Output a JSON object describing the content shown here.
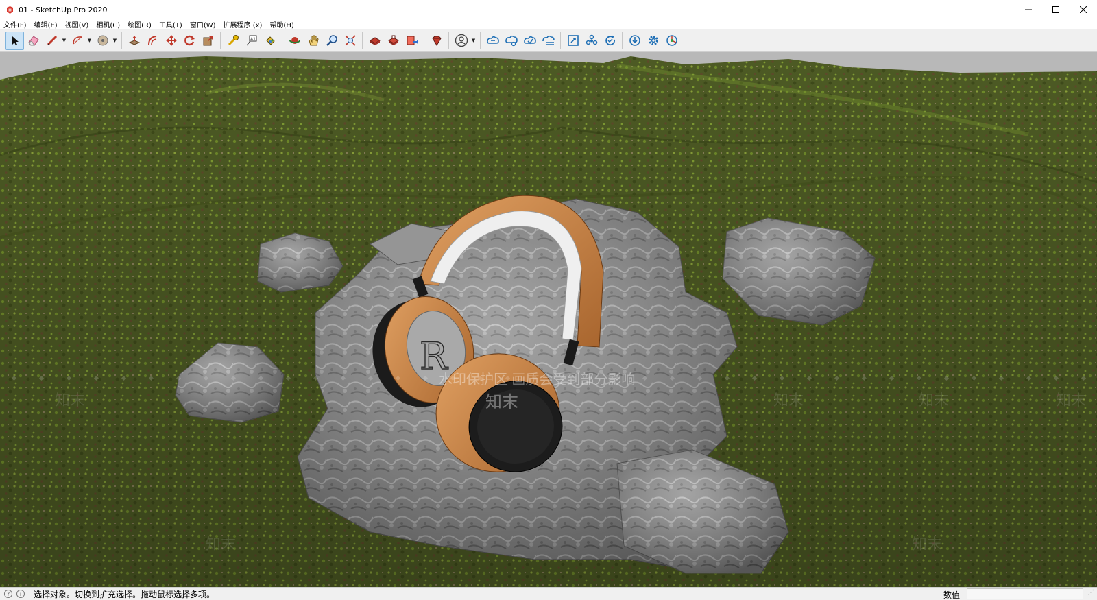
{
  "window": {
    "title": "01 - SketchUp Pro 2020",
    "app_icon": "sketchup-logo-icon",
    "controls": [
      "minimize-icon",
      "maximize-icon",
      "close-icon"
    ]
  },
  "menu": [
    {
      "label": "文件(F)"
    },
    {
      "label": "编辑(E)"
    },
    {
      "label": "视图(V)"
    },
    {
      "label": "相机(C)"
    },
    {
      "label": "绘图(R)"
    },
    {
      "label": "工具(T)"
    },
    {
      "label": "窗口(W)"
    },
    {
      "label": "扩展程序 (x)"
    },
    {
      "label": "帮助(H)"
    }
  ],
  "toolbar": {
    "groups": [
      [
        "select-icon",
        "eraser-icon",
        "line-icon",
        "arc-icon",
        "shapes-icon"
      ],
      [
        "push-pull-icon",
        "offset-icon",
        "move-icon",
        "rotate-icon",
        "scale-icon"
      ],
      [
        "tape-measure-icon",
        "text-icon",
        "paint-bucket-icon"
      ],
      [
        "orbit-icon",
        "pan-icon",
        "zoom-icon",
        "zoom-extents-icon"
      ],
      [
        "3d-warehouse-icon",
        "extension-warehouse-icon",
        "send-to-layout-icon"
      ],
      [
        "extension-manager-icon"
      ],
      [
        "account-icon"
      ],
      [
        "trimble-connect-icon",
        "trimble-share-icon",
        "cloud-open-icon",
        "cloud-save-icon"
      ],
      [
        "fit-window-icon",
        "component-icon",
        "refresh-icon",
        "download-icon",
        "settings-icon",
        "plugin-icon"
      ]
    ],
    "active": "select-icon"
  },
  "viewport": {
    "watermark_text": "水印保护区   画质会受到部分影响",
    "watermark_brand": "知末",
    "colors": {
      "sky": "#b9b9b9",
      "grass": "#4f5a25",
      "rock": "#8a8a8a",
      "leather": "#c8844a",
      "band": "#f2f2f2"
    }
  },
  "status": {
    "text": "选择对象。切换到扩充选择。拖动鼠标选择多项。",
    "measure_label": "数值",
    "measure_value": ""
  }
}
